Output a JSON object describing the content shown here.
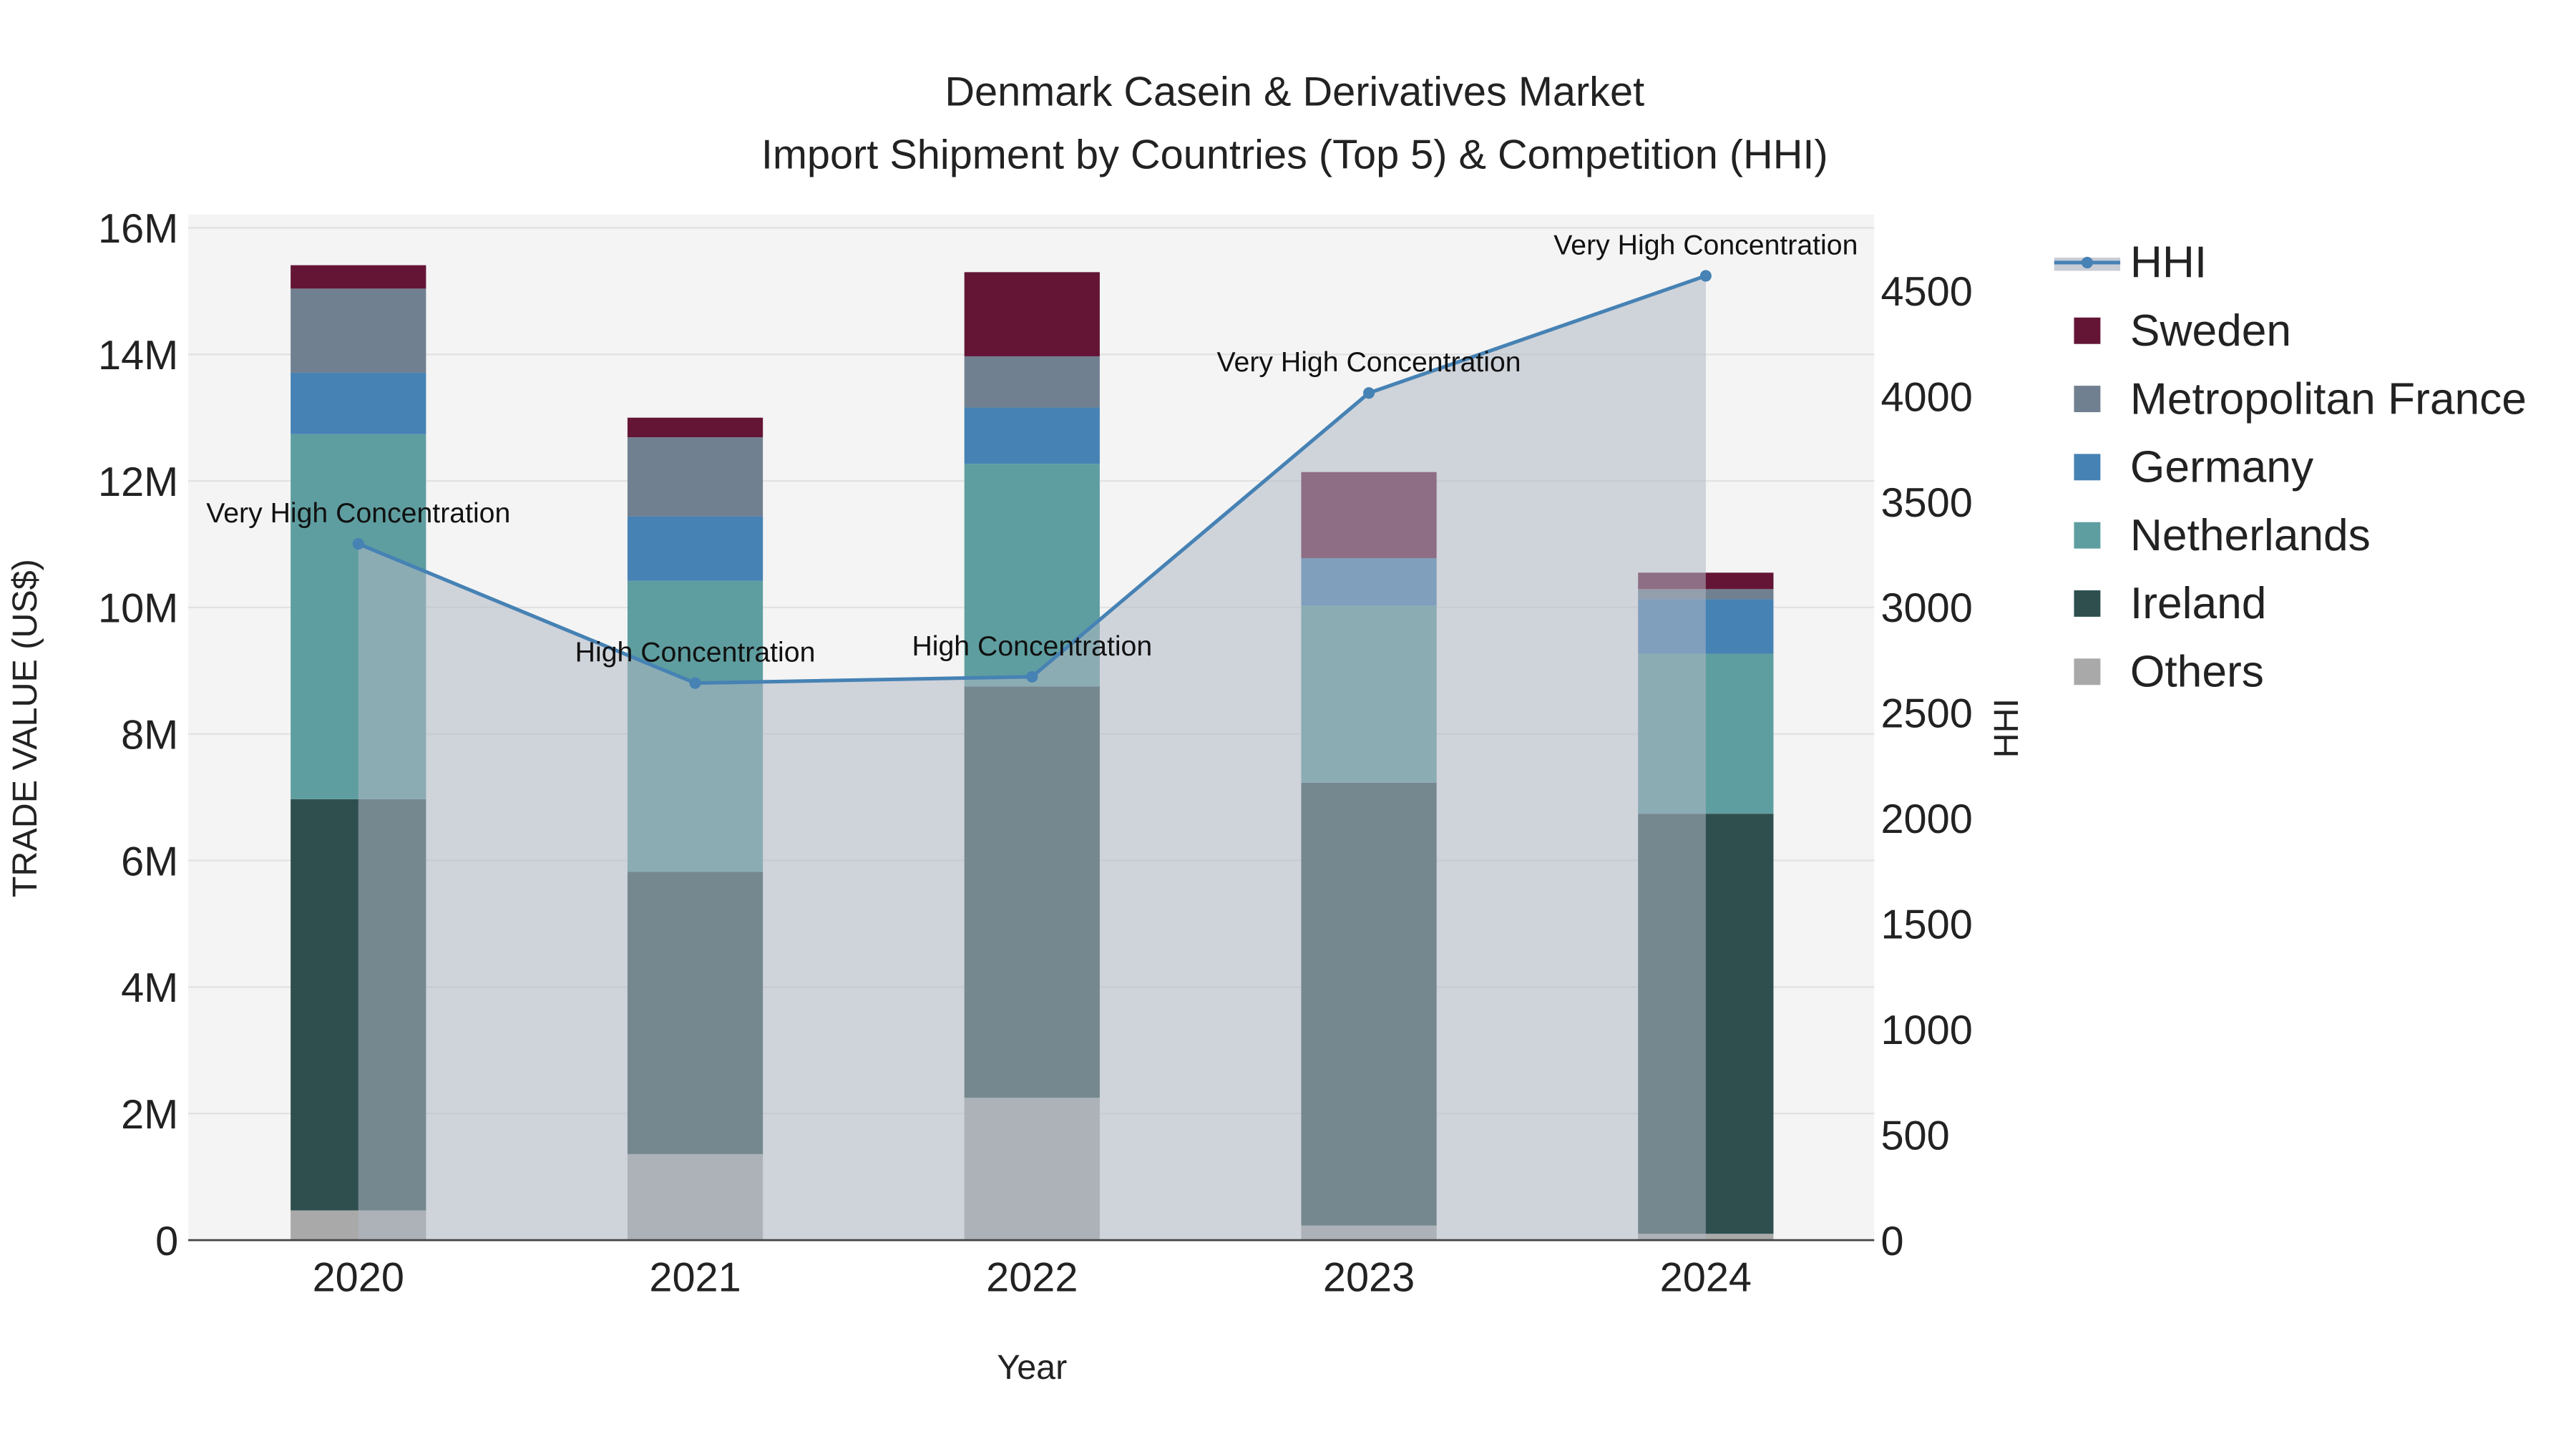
{
  "chart_data": {
    "type": "bar",
    "title": "Denmark Casein & Derivatives Market",
    "subtitle": "Import Shipment by Countries (Top 5) & Competition (HHI)",
    "xlabel": "Year",
    "ylabel": "TRADE VALUE (US$)",
    "y2label": "HHI",
    "categories": [
      "2020",
      "2021",
      "2022",
      "2023",
      "2024"
    ],
    "ylim": [
      0,
      16000000
    ],
    "y_ticks": [
      0,
      2000000,
      4000000,
      6000000,
      8000000,
      10000000,
      12000000,
      14000000,
      16000000
    ],
    "y_tick_labels": [
      "0",
      "2M",
      "4M",
      "6M",
      "8M",
      "10M",
      "12M",
      "14M",
      "16M"
    ],
    "y2lim": [
      0,
      4850
    ],
    "y2_ticks": [
      0,
      500,
      1000,
      1500,
      2000,
      2500,
      3000,
      3500,
      4000,
      4500
    ],
    "y2_tick_labels": [
      "0",
      "500",
      "1000",
      "1500",
      "2000",
      "2500",
      "3000",
      "3500",
      "4000",
      "4500"
    ],
    "grid": true,
    "legend_position": "right",
    "series": [
      {
        "name": "Others",
        "color": "#a9a9a9",
        "values": [
          470000,
          1360000,
          2250000,
          230000,
          100000
        ]
      },
      {
        "name": "Ireland",
        "color": "#2f4f4f",
        "values": [
          6500000,
          4460000,
          6500000,
          7000000,
          6640000
        ]
      },
      {
        "name": "Netherlands",
        "color": "#5f9ea0",
        "values": [
          5770000,
          4600000,
          3520000,
          2800000,
          2530000
        ]
      },
      {
        "name": "Germany",
        "color": "#4682b4",
        "values": [
          970000,
          1020000,
          890000,
          750000,
          860000
        ]
      },
      {
        "name": "Metropolitan France",
        "color": "#708090",
        "values": [
          1330000,
          1250000,
          810000,
          0,
          160000
        ]
      },
      {
        "name": "Sweden",
        "color": "#641536",
        "values": [
          370000,
          310000,
          1330000,
          1360000,
          260000
        ]
      }
    ],
    "hhi": {
      "name": "HHI",
      "color": "#4682b4",
      "values": [
        3300,
        2640,
        2670,
        4015,
        4570
      ],
      "annotations": [
        "Very High Concentration",
        "High Concentration",
        "High Concentration",
        "Very High Concentration",
        "Very High Concentration"
      ]
    },
    "legend_order": [
      "HHI",
      "Sweden",
      "Metropolitan France",
      "Germany",
      "Netherlands",
      "Ireland",
      "Others"
    ]
  }
}
